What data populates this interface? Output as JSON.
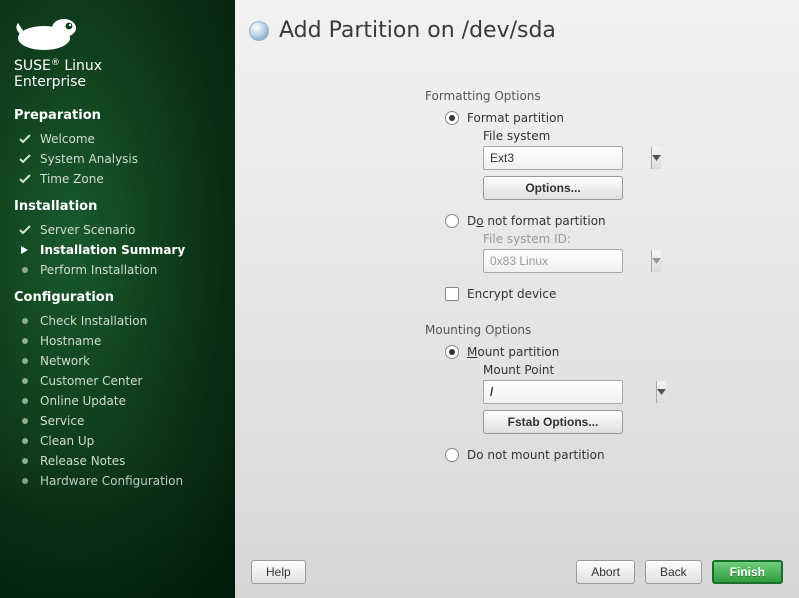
{
  "brand": {
    "line1": "SUSE",
    "line2": "Linux",
    "line3": "Enterprise"
  },
  "sidebar": {
    "sections": [
      {
        "title": "Preparation",
        "items": [
          {
            "label": "Welcome",
            "state": "done"
          },
          {
            "label": "System Analysis",
            "state": "done"
          },
          {
            "label": "Time Zone",
            "state": "done"
          }
        ]
      },
      {
        "title": "Installation",
        "items": [
          {
            "label": "Server Scenario",
            "state": "done"
          },
          {
            "label": "Installation Summary",
            "state": "current"
          },
          {
            "label": "Perform Installation",
            "state": "pending"
          }
        ]
      },
      {
        "title": "Configuration",
        "items": [
          {
            "label": "Check Installation",
            "state": "pending"
          },
          {
            "label": "Hostname",
            "state": "pending"
          },
          {
            "label": "Network",
            "state": "pending"
          },
          {
            "label": "Customer Center",
            "state": "pending"
          },
          {
            "label": "Online Update",
            "state": "pending"
          },
          {
            "label": "Service",
            "state": "pending"
          },
          {
            "label": "Clean Up",
            "state": "pending"
          },
          {
            "label": "Release Notes",
            "state": "pending"
          },
          {
            "label": "Hardware Configuration",
            "state": "pending"
          }
        ]
      }
    ]
  },
  "header": {
    "title": "Add Partition on /dev/sda"
  },
  "formatting": {
    "group_label": "Formatting Options",
    "format_label": "Format partition",
    "fs_label": "File system",
    "fs_value": "Ext3",
    "options_btn": "Options...",
    "noformat_label_pre": "D",
    "noformat_label_ul": "o",
    "noformat_label_post": " not format partition",
    "fsid_label_pre": "File system ",
    "fsid_label_ul": "I",
    "fsid_label_post": "D:",
    "fsid_value": "0x83 Linux",
    "encrypt_label": "Encrypt device"
  },
  "mounting": {
    "group_label": "Mounting Options",
    "mount_label_ul": "M",
    "mount_label_post": "ount partition",
    "mp_label_ul": "M",
    "mp_label_post": "ount Point",
    "mp_value": "/",
    "fstab_btn_pre": "Fs",
    "fstab_btn_ul": "t",
    "fstab_btn_post": "ab Options...",
    "nomount_label": "Do not mount partition"
  },
  "footer": {
    "help": "Help",
    "abort_pre": "Abo",
    "abort_ul": "r",
    "abort_post": "t",
    "back_ul": "B",
    "back_post": "ack",
    "finish_ul": "F",
    "finish_post": "inish"
  }
}
